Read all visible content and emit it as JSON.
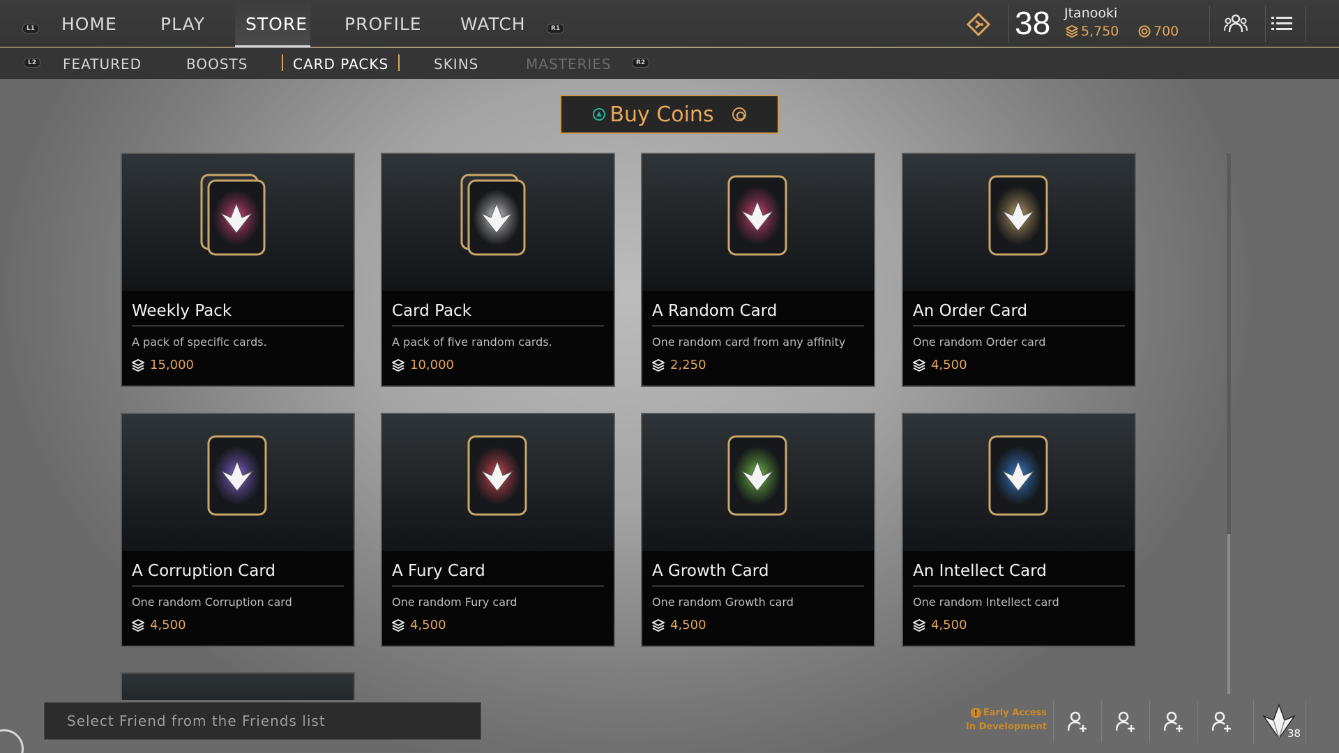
{
  "nav": {
    "hint_left": "L1",
    "hint_right": "R1",
    "items": [
      "HOME",
      "PLAY",
      "STORE",
      "PROFILE",
      "WATCH"
    ],
    "active": "STORE"
  },
  "player": {
    "level": "38",
    "name": "Jtanooki",
    "gems": "5,750",
    "coins": "700"
  },
  "subnav": {
    "hint_left": "L2",
    "hint_right": "R2",
    "items": [
      "FEATURED",
      "BOOSTS",
      "CARD PACKS",
      "SKINS",
      "MASTERIES"
    ],
    "active": "CARD PACKS",
    "disabled": "MASTERIES"
  },
  "buy_coins": {
    "label": "Buy Coins"
  },
  "cards": [
    {
      "title": "Weekly Pack",
      "desc": "A pack of specific cards.",
      "price": "15,000",
      "icon": "card-pack-icon",
      "color": "#e0457a"
    },
    {
      "title": "Card Pack",
      "desc": "A pack of five random cards.",
      "price": "10,000",
      "icon": "card-pack-icon",
      "color": "#d8d8d8"
    },
    {
      "title": "A Random Card",
      "desc": "One random card from any affinity",
      "price": "2,250",
      "icon": "card-icon",
      "color": "#e0457a"
    },
    {
      "title": "An Order Card",
      "desc": "One random Order card",
      "price": "4,500",
      "icon": "card-icon",
      "color": "#c9a76a"
    },
    {
      "title": "A Corruption Card",
      "desc": "One random Corruption card",
      "price": "4,500",
      "icon": "card-icon",
      "color": "#8a6ae0"
    },
    {
      "title": "A Fury Card",
      "desc": "One random Fury card",
      "price": "4,500",
      "icon": "card-icon",
      "color": "#e04a5a"
    },
    {
      "title": "A Growth Card",
      "desc": "One random Growth card",
      "price": "4,500",
      "icon": "card-icon",
      "color": "#7ad04a"
    },
    {
      "title": "An Intellect Card",
      "desc": "One random Intellect card",
      "price": "4,500",
      "icon": "card-icon",
      "color": "#3a8ae0"
    }
  ],
  "footer": {
    "friend_placeholder": "Select Friend from the Friends list",
    "early_access_line1": "Early Access",
    "early_access_line2": "In Development",
    "badge_level": "38"
  },
  "colors": {
    "accent": "#c89a55",
    "price": "#e6a55c",
    "warning": "#c98a2a"
  }
}
